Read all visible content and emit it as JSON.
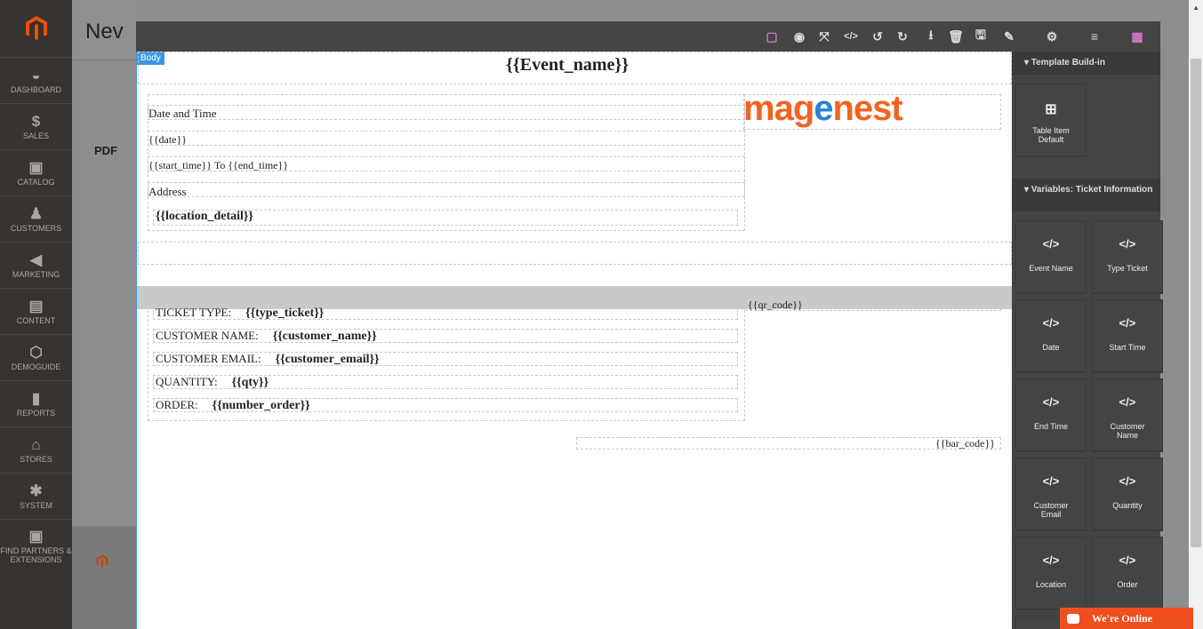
{
  "admin": {
    "nav": [
      {
        "label": "DASHBOARD",
        "icon": "dashboard-icon",
        "glyph": "◒"
      },
      {
        "label": "SALES",
        "icon": "dollar-icon",
        "glyph": "$"
      },
      {
        "label": "CATALOG",
        "icon": "box-icon",
        "glyph": "▣"
      },
      {
        "label": "CUSTOMERS",
        "icon": "person-icon",
        "glyph": "♟"
      },
      {
        "label": "MARKETING",
        "icon": "megaphone-icon",
        "glyph": "◀"
      },
      {
        "label": "CONTENT",
        "icon": "content-icon",
        "glyph": "▤"
      },
      {
        "label": "DEMOGUIDE",
        "icon": "hexagon-icon",
        "glyph": "⬡"
      },
      {
        "label": "REPORTS",
        "icon": "bar-chart-icon",
        "glyph": "▮"
      },
      {
        "label": "STORES",
        "icon": "store-icon",
        "glyph": "⌂"
      },
      {
        "label": "SYSTEM",
        "icon": "gear-icon",
        "glyph": "✱"
      },
      {
        "label": "FIND PARTNERS & EXTENSIONS",
        "icon": "cube-icon",
        "glyph": "▣"
      }
    ],
    "page_title": "Nev",
    "pdf_label": "PDF"
  },
  "editor": {
    "body_badge": "Body",
    "toolbar": [
      {
        "name": "component-outline-icon",
        "glyph": "▢",
        "color": "#d278c9"
      },
      {
        "name": "preview-eye-icon",
        "glyph": "◉"
      },
      {
        "name": "fullscreen-icon",
        "glyph": "⤧"
      },
      {
        "name": "code-view-icon",
        "glyph": "</>"
      },
      {
        "name": "undo-icon",
        "glyph": "↺"
      },
      {
        "name": "redo-icon",
        "glyph": "↻"
      },
      {
        "name": "import-icon",
        "glyph": "⭳"
      },
      {
        "name": "trash-icon",
        "glyph": "🗑"
      },
      {
        "name": "save-icon",
        "glyph": "🖫"
      },
      {
        "name": "style-manager-brush-icon",
        "glyph": "✎"
      },
      {
        "name": "settings-gear-icon",
        "glyph": "⚙"
      },
      {
        "name": "layer-manager-icon",
        "glyph": "≡"
      },
      {
        "name": "blocks-grid-icon",
        "glyph": "▦",
        "color": "#d278c9"
      }
    ],
    "canvas": {
      "event_name": "{{Event_name}}",
      "logo": {
        "part1": "mag",
        "part2": "e",
        "part3": "nest"
      },
      "date_time_label": "Date and Time",
      "date_var": "{{date}}",
      "start_var": "{{start_time}}",
      "to_text": "To",
      "end_var": "{{end_time}}",
      "address_label": "Address",
      "location_var": "{{location_detail}}",
      "qr_code": "{{qr_code}}",
      "ticket_rows": [
        {
          "label": "TICKET TYPE:",
          "value": "{{type_ticket}}"
        },
        {
          "label": "CUSTOMER NAME:",
          "value": "{{customer_name}}"
        },
        {
          "label": "CUSTOMER EMAIL:",
          "value": "{{customer_email}}"
        },
        {
          "label": "QUANTITY:",
          "value": "{{qty}}"
        },
        {
          "label": "ORDER:",
          "value": "{{number_order}}"
        }
      ],
      "bar_code": "{{bar_code}}"
    },
    "panel": {
      "section1": "▾  Template Build-in",
      "table_block": "Table Item Default",
      "section2": "▾  Variables: Ticket Information",
      "variables": [
        "Event Name",
        "Type Ticket",
        "Date",
        "Start Time",
        "End Time",
        "Customer Name",
        "Customer Email",
        "Quantity",
        "Location",
        "Order"
      ],
      "code_glyph": "</>",
      "table_glyph": "⊞"
    }
  },
  "chat": {
    "label": "We're Online",
    "color": "#ef4f1f"
  }
}
